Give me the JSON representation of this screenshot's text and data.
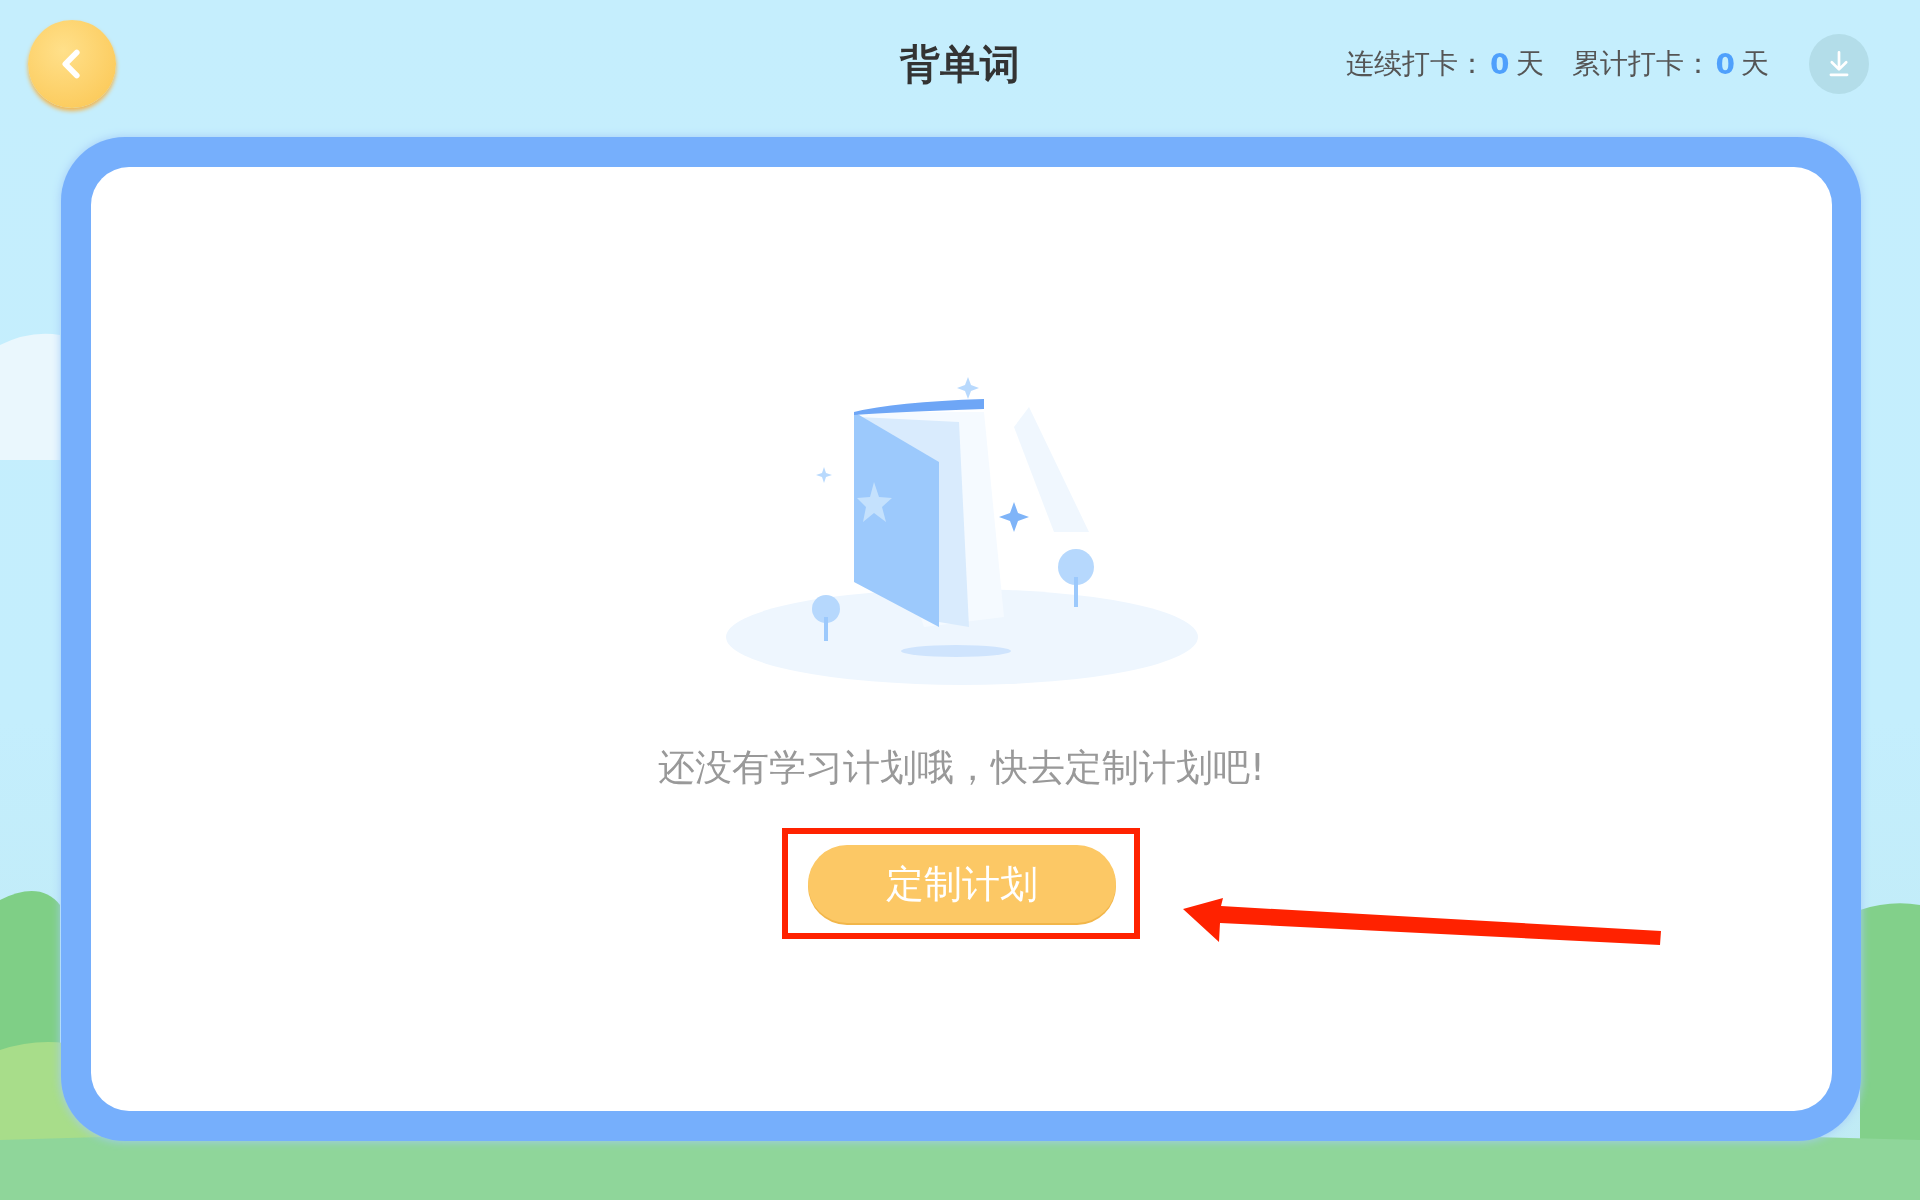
{
  "header": {
    "title": "背单词",
    "stats": [
      {
        "label": "连续打卡：",
        "value": "0",
        "unit": "天"
      },
      {
        "label": "累计打卡：",
        "value": "0",
        "unit": "天"
      }
    ]
  },
  "empty_state": {
    "message": "还没有学习计划哦，快去定制计划吧!",
    "button": "定制计划"
  },
  "annotations": {
    "highlight_box": true,
    "arrow": true
  }
}
